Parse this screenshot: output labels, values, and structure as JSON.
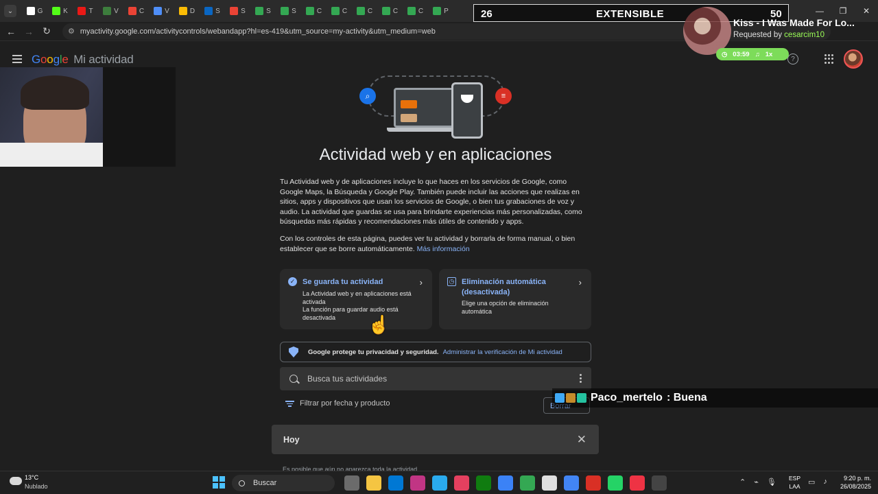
{
  "browser": {
    "tabs": [
      {
        "label": "G",
        "color": "#ffffff"
      },
      {
        "label": "K",
        "color": "#53fc18"
      },
      {
        "label": "T",
        "color": "#e91916"
      },
      {
        "label": "V",
        "color": "#3d7d3d"
      },
      {
        "label": "C",
        "color": "#ea4335"
      },
      {
        "label": "V",
        "color": "#4f8ef7"
      },
      {
        "label": "D",
        "color": "#fbbc05"
      },
      {
        "label": "S",
        "color": "#0a66c2"
      },
      {
        "label": "S",
        "color": "#ea4335"
      },
      {
        "label": "S",
        "color": "#34a853"
      },
      {
        "label": "S",
        "color": "#34a853"
      },
      {
        "label": "C",
        "color": "#34a853"
      },
      {
        "label": "C",
        "color": "#34a853"
      },
      {
        "label": "C",
        "color": "#34a853"
      },
      {
        "label": "C",
        "color": "#34a853"
      },
      {
        "label": "C",
        "color": "#34a853"
      },
      {
        "label": "P",
        "color": "#34a853"
      }
    ],
    "url": "myactivity.google.com/activitycontrols/webandapp?hl=es-419&utm_source=my-activity&utm_medium=web"
  },
  "app": {
    "logo_google": [
      "G",
      "o",
      "o",
      "g",
      "l",
      "e"
    ],
    "logo_product": "Mi actividad",
    "help": "?"
  },
  "main": {
    "title": "Actividad web y en aplicaciones",
    "description_1": "Tu Actividad web y de aplicaciones incluye lo que haces en los servicios de Google, como Google Maps, la Búsqueda y Google Play. También puede incluir las acciones que realizas en sitios, apps y dispositivos que usan los servicios de Google, o bien tus grabaciones de voz y audio. La actividad que guardas se usa para brindarte experiencias más personalizadas, como búsquedas más rápidas y recomendaciones más útiles de contenido y apps.",
    "description_2": "Con los controles de esta página, puedes ver tu actividad y borrarla de forma manual, o bien establecer que se borre automáticamente. ",
    "more_info_link": "Más información",
    "card_saving": {
      "title": "Se guarda tu actividad",
      "line1": "La Actividad web y en aplicaciones está activada",
      "line2": "La función para guardar audio está desactivada"
    },
    "card_autodelete": {
      "title": "Eliminación automática (desactivada)",
      "line1": "Elige una opción de eliminación automática"
    },
    "privacy_text": "Google protege tu privacidad y seguridad.",
    "privacy_link": "Administrar la verificación de Mi actividad",
    "search_placeholder": "Busca tus actividades",
    "filter_label": "Filtrar por fecha y producto",
    "delete_button": "Borrar",
    "today_header": "Hoy",
    "partial_text": "Es posible que aún no aparezca toda la actividad"
  },
  "stream_overlay": {
    "counter_left": "26",
    "banner_word": "EXTENSIBLE",
    "counter_right": "50",
    "song_title": "Kiss - I Was Made For Lo...",
    "requested_by_label": "Requested by ",
    "requested_by_user": "cesarcim10",
    "time": "03:59",
    "speed": "1x",
    "chat_user": "Paco_mertelo",
    "chat_message": ": Buena"
  },
  "taskbar": {
    "temperature": "13°C",
    "weather": "Nublado",
    "search_label": "Buscar",
    "lang_top": "ESP",
    "lang_bottom": "LAA",
    "time": "9:20 p. m.",
    "date": "26/08/2025",
    "app_icon_colors": [
      "#6b6b6b",
      "#f5c542",
      "#0078d4",
      "#c13584",
      "#2aabee",
      "#e4405f",
      "#107c10",
      "#3b82f6",
      "#34a853",
      "#e0e0e0",
      "#4285f4",
      "#d93025",
      "#25d366",
      "#e34",
      "#444"
    ]
  }
}
